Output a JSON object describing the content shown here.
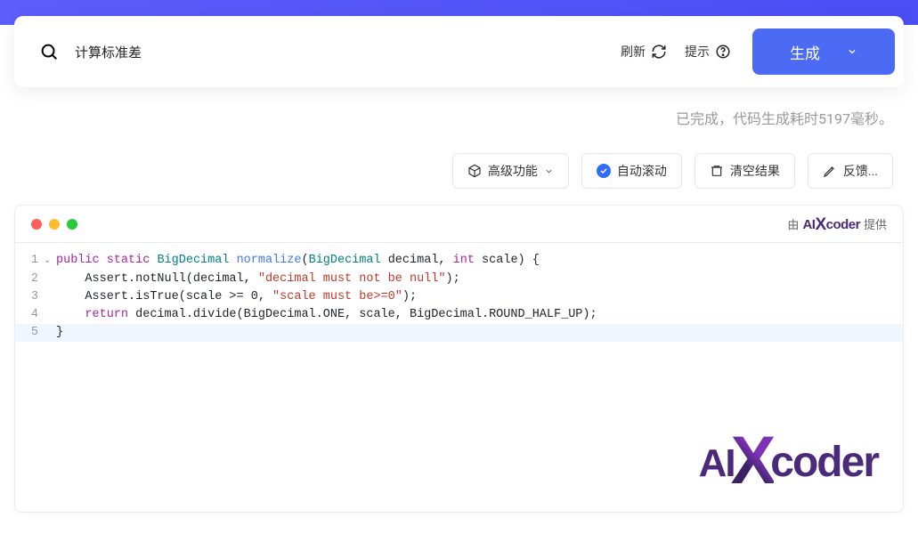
{
  "search": {
    "value": "计算标准差",
    "refresh_label": "刷新",
    "tip_label": "提示",
    "generate_label": "生成"
  },
  "status": {
    "text": "已完成，代码生成耗时5197毫秒。"
  },
  "toolbar": {
    "advanced_label": "高级功能",
    "autoscroll_label": "自动滚动",
    "clear_label": "清空结果",
    "feedback_label": "反馈..."
  },
  "provider": {
    "by_prefix": "由",
    "brand_ai": "AI",
    "brand_x": "X",
    "brand_coder": "coder",
    "by_suffix": "提供"
  },
  "code": {
    "lines": [
      {
        "n": "1",
        "fold": "⌄",
        "hl": false
      },
      {
        "n": "2",
        "fold": "",
        "hl": false
      },
      {
        "n": "3",
        "fold": "",
        "hl": false
      },
      {
        "n": "4",
        "fold": "",
        "hl": false
      },
      {
        "n": "5",
        "fold": "",
        "hl": true
      }
    ],
    "tokens": {
      "l1_kw1": "public",
      "l1_kw2": "static",
      "l1_type": "BigDecimal",
      "l1_fn": "normalize",
      "l1_open": "(",
      "l1_ptype1": "BigDecimal",
      "l1_pname1": " decimal",
      "l1_comma": ", ",
      "l1_ptype2": "int",
      "l1_pname2": " scale",
      "l1_close": ") {",
      "l2": "    Assert.notNull(decimal, ",
      "l2_str": "\"decimal must not be null\"",
      "l2_end": ");",
      "l3": "    Assert.isTrue(scale >= 0, ",
      "l3_str": "\"scale must be>=0\"",
      "l3_end": ");",
      "l4_kw": "return",
      "l4_rest": " decimal.divide(BigDecimal.ONE, scale, BigDecimal.ROUND_HALF_UP);",
      "l5": "}"
    }
  },
  "watermark": {
    "ai": "AI",
    "x": "X",
    "coder": "coder"
  }
}
